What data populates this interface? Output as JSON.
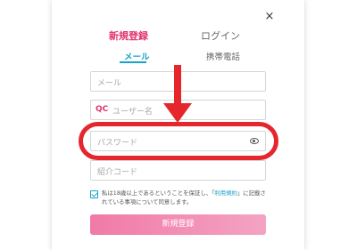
{
  "close_icon": "×",
  "tabs": {
    "signup": "新規登録",
    "login": "ログイン"
  },
  "subtabs": {
    "mail": "メール",
    "phone": "携帯電話"
  },
  "fields": {
    "mail_placeholder": "メール",
    "user_prefix": "QC",
    "user_placeholder": "ユーザー名",
    "password_placeholder": "パスワード",
    "invite_placeholder": "紹介コード"
  },
  "terms": {
    "before": "私は18歳以上であるということを保証し、「",
    "link": "利用規約",
    "after": "」に記載されている事項について同意します。"
  },
  "submit_label": "新規登録",
  "colors": {
    "accent_pink": "#e0336f",
    "accent_blue": "#1aa1c9",
    "annotation_red": "#e5262c"
  }
}
